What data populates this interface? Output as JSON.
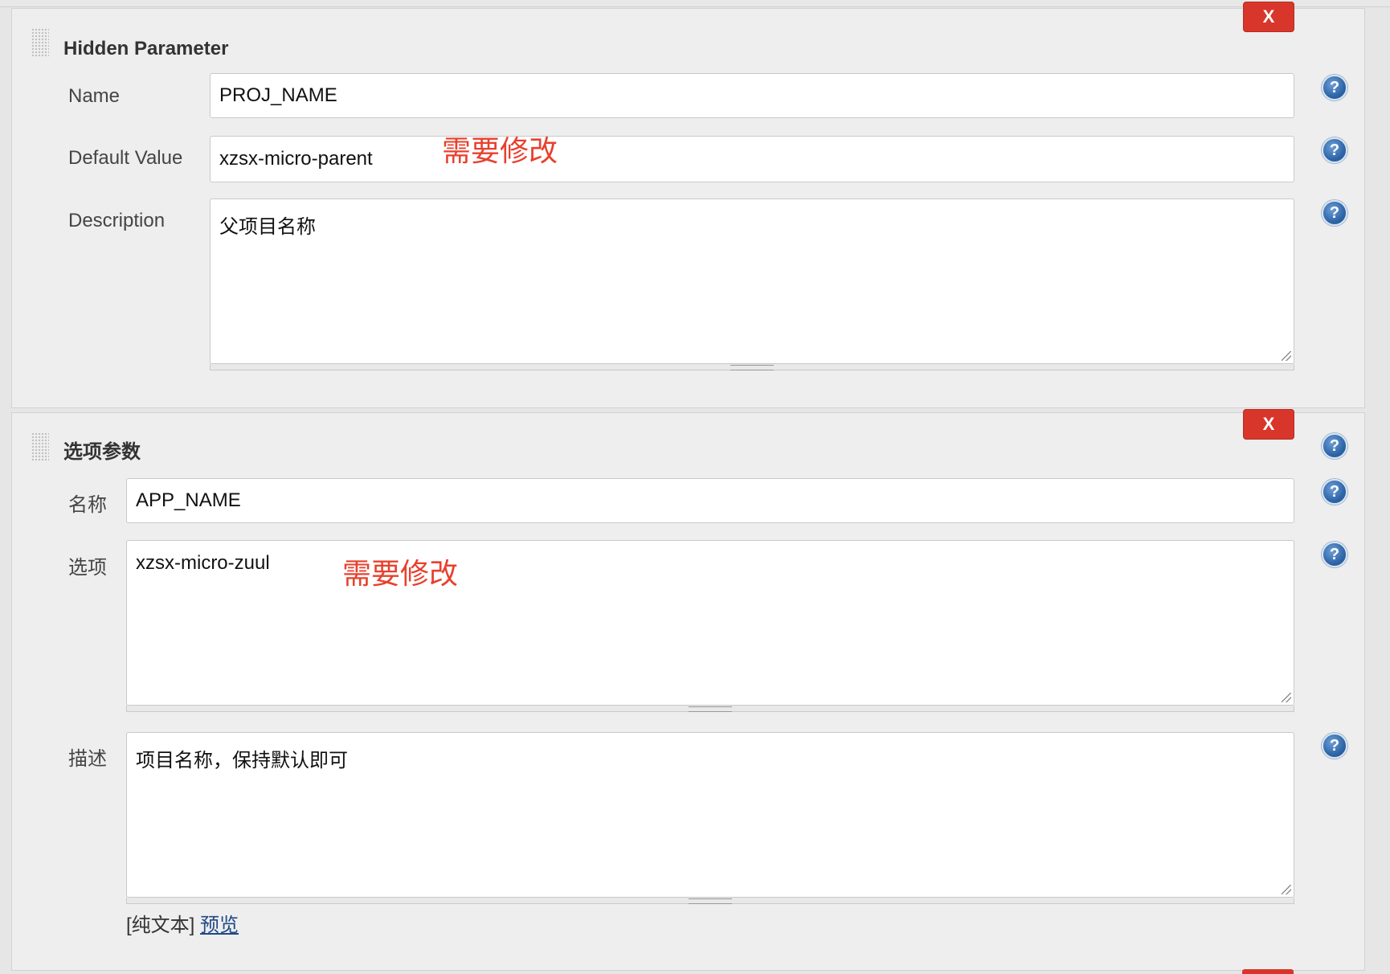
{
  "hidden_parameter": {
    "title": "Hidden Parameter",
    "delete_label": "X",
    "name_label": "Name",
    "name_value": "PROJ_NAME",
    "default_label": "Default Value",
    "default_value": "xzsx-micro-parent",
    "description_label": "Description",
    "description_value": "父项目名称",
    "annotation": "需要修改"
  },
  "choice_parameter": {
    "title": "选项参数",
    "delete_label": "X",
    "name_label": "名称",
    "name_value": "APP_NAME",
    "choices_label": "选项",
    "choices_value": "xzsx-micro-zuul",
    "description_label": "描述",
    "description_value": "项目名称，保持默认即可",
    "annotation": "需要修改",
    "format_plain": "[纯文本]",
    "preview_link": "预览"
  },
  "help_icon_glyph": "?",
  "colors": {
    "delete_button": "#d9362b",
    "annotation": "#e8402d",
    "help_icon": "#2e66a8",
    "link": "#204a87"
  }
}
